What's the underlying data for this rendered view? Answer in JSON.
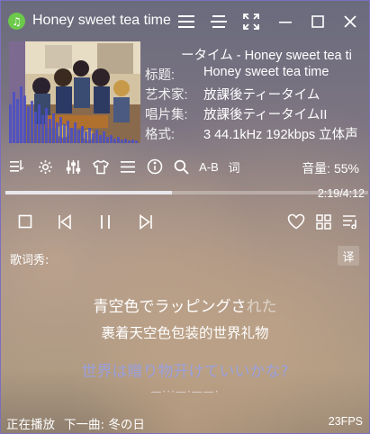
{
  "window": {
    "title": "Honey sweet tea time",
    "icons": [
      "app-music-icon",
      "menu-icon",
      "compact-icon",
      "fullscreen-icon",
      "minimize-icon",
      "maximize-icon",
      "close-icon"
    ]
  },
  "song_info": {
    "top_line_label": "",
    "top_line_value": "ータイム - Honey sweet tea ti",
    "title_label": "标题:",
    "title_value": "Honey sweet tea time",
    "artist_label": "艺术家:",
    "artist_value": "放課後ティータイム",
    "album_label": "唱片集:",
    "album_value": "放課後ティータイムII",
    "format_label": "格式:",
    "format_value": "3 44.1kHz 192kbps 立体声"
  },
  "toolbar": {
    "items": [
      "playlist-icon",
      "settings-icon",
      "equalizer-icon",
      "skin-icon",
      "more-menu-icon",
      "info-icon",
      "search-icon",
      "ab-repeat",
      "lyrics-toggle"
    ],
    "ab_label": "A-B",
    "lyrics_label": "词",
    "volume_text": "音量: 55%"
  },
  "progress": {
    "elapsed_fraction": 0.458,
    "time_text": "2:19/4:12"
  },
  "controls": [
    "stop-icon",
    "previous-icon",
    "pause-icon",
    "next-icon",
    "favorite-icon",
    "grid-icon",
    "playlist-add-icon"
  ],
  "lyrics": {
    "title": "歌词秀:",
    "translate_label": "译",
    "line1_sung": "青空色でラッピングさ",
    "line1_rest": "れた",
    "line2": "裹着天空色包装的世界礼物",
    "line3": "世界は贈り物开けていいかな?",
    "line4": "—···—·——·"
  },
  "status": {
    "now_playing": "正在播放",
    "next_song": "下一曲: 冬の日",
    "fps": "23FPS"
  },
  "colors": {
    "accent_border": "#7b6fc0",
    "app_icon": "#6cc94a",
    "next_lyric": "#9a9fdc"
  }
}
